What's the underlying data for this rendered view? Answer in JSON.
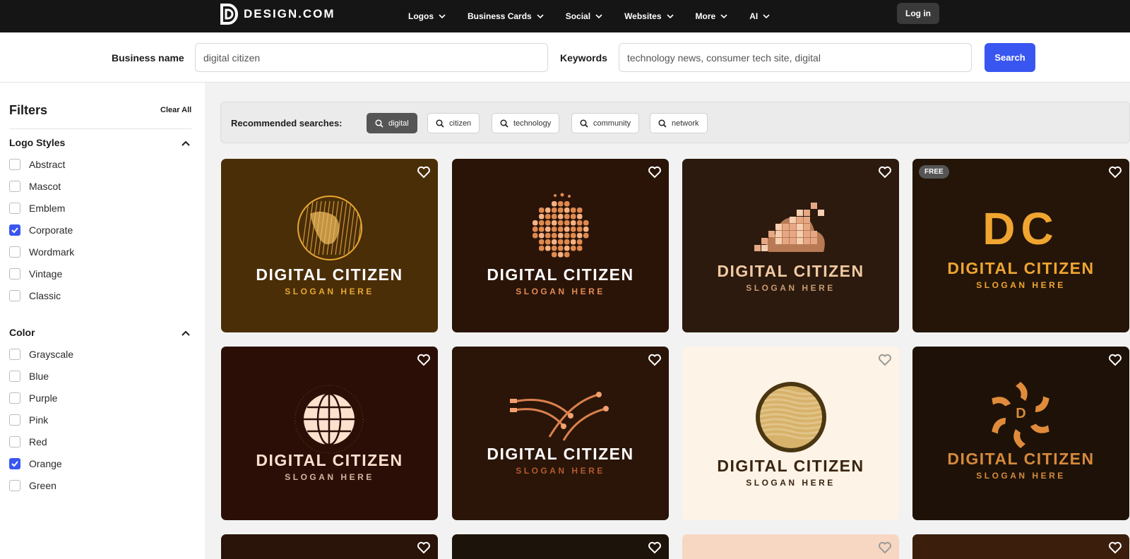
{
  "nav": {
    "brand": "DESIGN.COM",
    "items": [
      "Logos",
      "Business Cards",
      "Social",
      "Websites",
      "More",
      "AI"
    ],
    "login": "Log in"
  },
  "search": {
    "business_label": "Business name",
    "business_value": "digital citizen",
    "keywords_label": "Keywords",
    "keywords_value": "technology news, consumer tech site, digital",
    "button": "Search"
  },
  "sidebar": {
    "title": "Filters",
    "clear": "Clear All",
    "styles_title": "Logo Styles",
    "styles": [
      {
        "label": "Abstract",
        "checked": false
      },
      {
        "label": "Mascot",
        "checked": false
      },
      {
        "label": "Emblem",
        "checked": false
      },
      {
        "label": "Corporate",
        "checked": true
      },
      {
        "label": "Wordmark",
        "checked": false
      },
      {
        "label": "Vintage",
        "checked": false
      },
      {
        "label": "Classic",
        "checked": false
      }
    ],
    "color_title": "Color",
    "colors": [
      {
        "label": "Grayscale",
        "checked": false
      },
      {
        "label": "Blue",
        "checked": false
      },
      {
        "label": "Purple",
        "checked": false
      },
      {
        "label": "Pink",
        "checked": false
      },
      {
        "label": "Red",
        "checked": false
      },
      {
        "label": "Orange",
        "checked": true
      },
      {
        "label": "Green",
        "checked": false
      }
    ]
  },
  "recommended": {
    "label": "Recommended searches:",
    "chips": [
      "digital",
      "citizen",
      "technology",
      "community",
      "network"
    ],
    "active": "digital"
  },
  "cards": [
    {
      "name": "DIGITAL CITIZEN",
      "slogan": "SLOGAN HERE",
      "bg": "#4a2e08",
      "name_color": "#ffffff",
      "slogan_color": "#e8a733",
      "art": "globe-lines"
    },
    {
      "name": "DIGITAL CITIZEN",
      "slogan": "SLOGAN HERE",
      "bg": "#2a1408",
      "name_color": "#ffffff",
      "slogan_color": "#e28a56",
      "art": "mosaic-sphere"
    },
    {
      "name": "DIGITAL CITIZEN",
      "slogan": "SLOGAN HERE",
      "bg": "#2b1a0d",
      "name_color": "#f1c9a3",
      "slogan_color": "#c99a75",
      "art": "pixel-cloud"
    },
    {
      "name": "DIGITAL CITIZEN",
      "slogan": "SLOGAN HERE",
      "bg": "#241508",
      "name_color": "#f0a531",
      "slogan_color": "#f0a531",
      "monogram": "DC",
      "free": "FREE",
      "art": "monogram"
    },
    {
      "name": "DIGITAL CITIZEN",
      "slogan": "SLOGAN HERE",
      "bg": "#2b0f06",
      "name_color": "#fde1cf",
      "slogan_color": "#d6b3a0",
      "art": "wire-globe"
    },
    {
      "name": "DIGITAL CITIZEN",
      "slogan": "SLOGAN HERE",
      "bg": "#2a1508",
      "name_color": "#ffffff",
      "slogan_color": "#b45a2f",
      "art": "circuit-arcs"
    },
    {
      "name": "DIGITAL CITIZEN",
      "slogan": "SLOGAN HERE",
      "bg": "#fdf3e6",
      "name_color": "#3a2410",
      "slogan_color": "#3a2410",
      "art": "wave-circle"
    },
    {
      "name": "DIGITAL CITIZEN",
      "slogan": "SLOGAN HERE",
      "bg": "#1e1208",
      "name_color": "#d58a3d",
      "slogan_color": "#d58a3d",
      "monogram": "D",
      "art": "star-emblem"
    }
  ],
  "partial_cards": [
    "#2a1308",
    "#1c130a",
    "#f7d7c2",
    "#3b1f0c"
  ]
}
